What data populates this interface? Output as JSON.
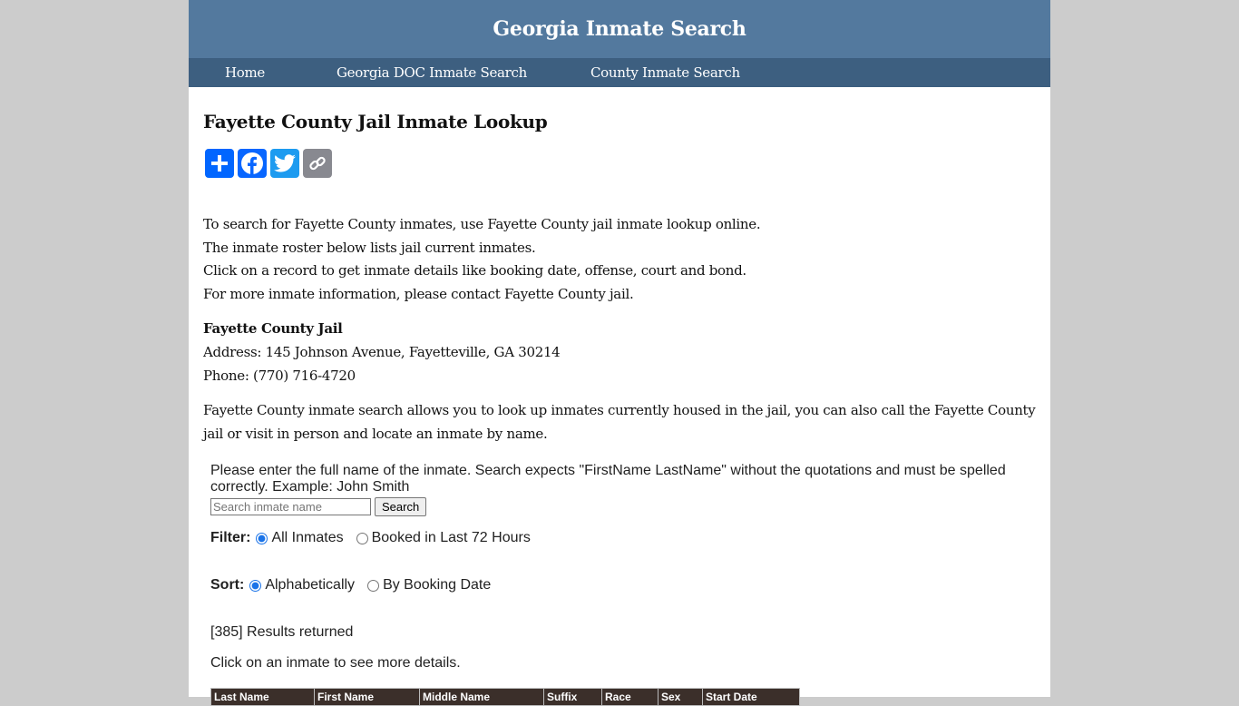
{
  "header": {
    "title": "Georgia Inmate Search"
  },
  "nav": {
    "items": [
      {
        "label": "Home"
      },
      {
        "label": "Georgia DOC Inmate Search"
      },
      {
        "label": "County Inmate Search"
      }
    ]
  },
  "main": {
    "title": "Fayette County Jail Inmate Lookup",
    "share": [
      {
        "name": "share",
        "icon": "plus-icon",
        "color": "#0166ff"
      },
      {
        "name": "facebook",
        "icon": "facebook-icon",
        "color": "#0866ff"
      },
      {
        "name": "twitter",
        "icon": "twitter-icon",
        "color": "#1d9bf0"
      },
      {
        "name": "copy-link",
        "icon": "link-icon",
        "color": "#888990"
      }
    ],
    "intro": [
      "To search for Fayette County inmates, use Fayette County jail inmate lookup online.",
      "The inmate roster below lists jail current inmates.",
      "Click on a record to get inmate details like booking date, offense, court and bond.",
      "For more inmate information, please contact Fayette County jail."
    ],
    "jail": {
      "name": "Fayette County Jail",
      "address": "Address: 145 Johnson Avenue, Fayetteville, GA 30214",
      "phone": "Phone: (770) 716-4720"
    },
    "about": "Fayette County inmate search allows you to look up inmates currently housed in the jail, you can also call the Fayette County jail or visit in person and locate an inmate by name."
  },
  "search": {
    "instructions": "Please enter the full name of the inmate. Search expects \"FirstName LastName\" without the quotations and must be spelled correctly. Example: John Smith",
    "placeholder": "Search inmate name",
    "value": "",
    "button_label": "Search",
    "filter": {
      "label": "Filter:",
      "options": [
        {
          "label": "All Inmates",
          "checked": true
        },
        {
          "label": "Booked in Last 72 Hours",
          "checked": false
        }
      ]
    },
    "sort": {
      "label": "Sort:",
      "options": [
        {
          "label": "Alphabetically",
          "checked": true
        },
        {
          "label": "By Booking Date",
          "checked": false
        }
      ]
    },
    "results_text": "[385] Results returned",
    "click_note": "Click on an inmate to see more details."
  },
  "table": {
    "columns": [
      "Last Name",
      "First Name",
      "Middle Name",
      "Suffix",
      "Race",
      "Sex",
      "Start Date"
    ]
  }
}
